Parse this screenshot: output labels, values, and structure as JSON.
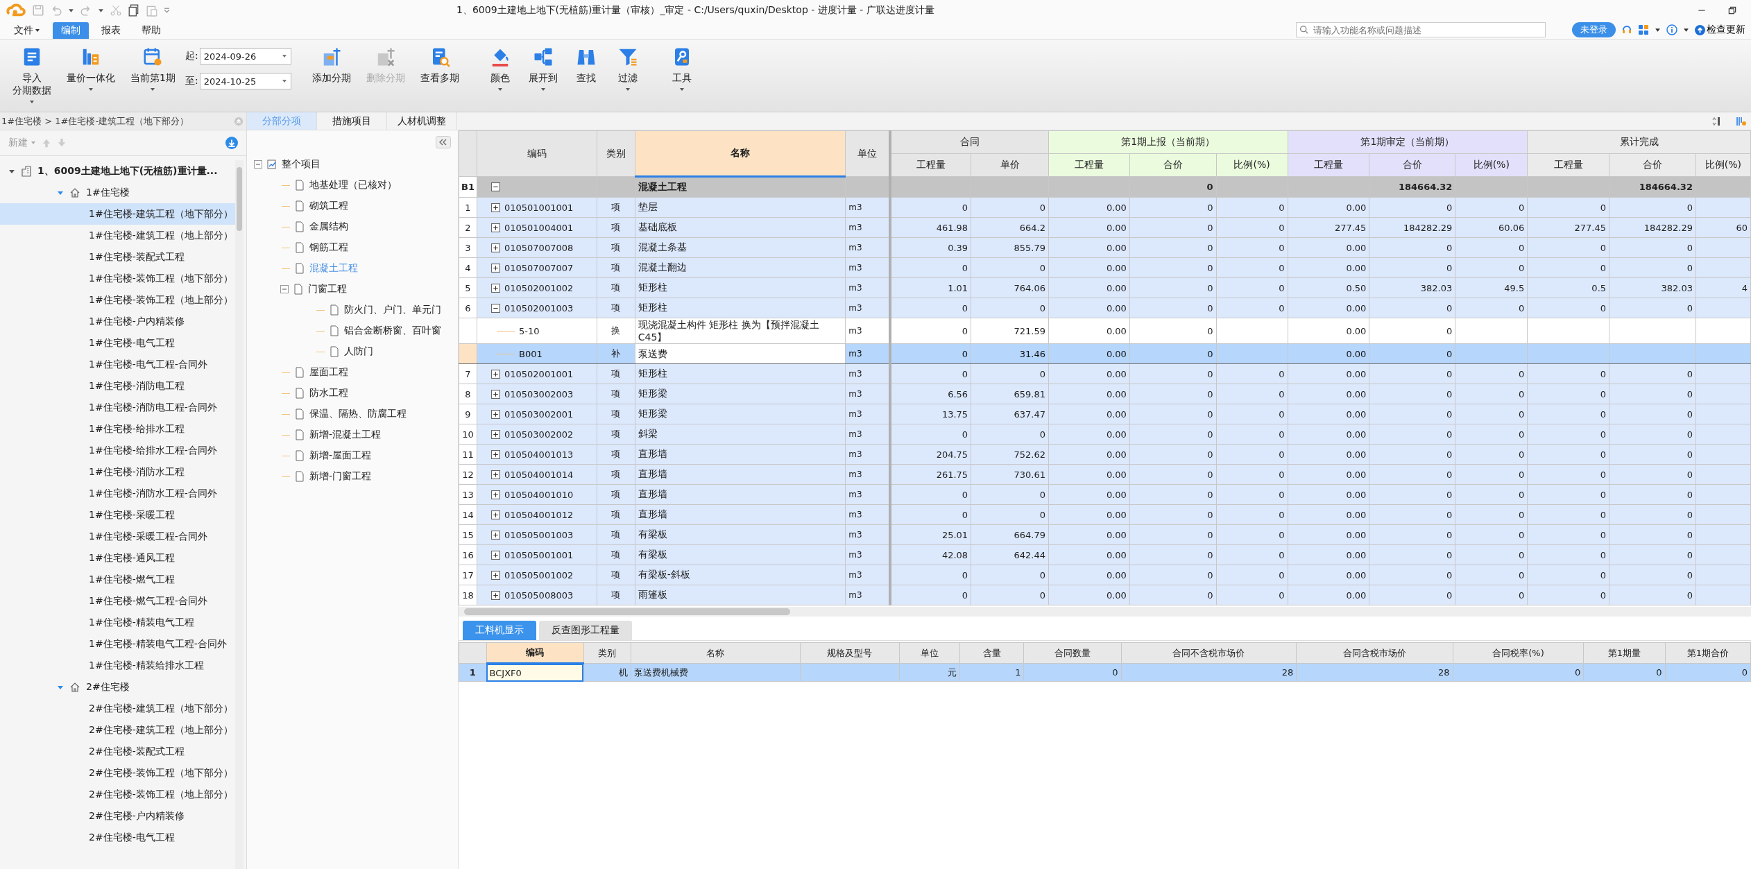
{
  "title_bar": {
    "title": "1、6009土建地上地下(无植筋)重计量（审核）_审定 - C:/Users/quxin/Desktop - 进度计量 - 广联达进度计量"
  },
  "menu": [
    {
      "label": "文件",
      "selected": false,
      "has_menu": true
    },
    {
      "label": "编制",
      "selected": true,
      "has_menu": false
    },
    {
      "label": "报表",
      "selected": false,
      "has_menu": false
    },
    {
      "label": "帮助",
      "selected": false,
      "has_menu": false
    }
  ],
  "search": {
    "placeholder": "请输入功能名称或问题描述"
  },
  "login_button": "未登录",
  "update_button": "检查更新",
  "ribbon": {
    "left_buttons": [
      {
        "label": "导入",
        "sub_label": "分期数据",
        "has_menu": true,
        "disabled": false
      },
      {
        "label": "量价一体化",
        "has_menu": true,
        "disabled": false
      },
      {
        "label": "当前第1期",
        "has_menu": true,
        "disabled": false
      }
    ],
    "period": {
      "start_label": "起:",
      "start": "2024-09-26",
      "end_label": "至:",
      "end": "2024-10-25"
    },
    "right_buttons": [
      {
        "label": "添加分期",
        "has_menu": false,
        "disabled": false
      },
      {
        "label": "删除分期",
        "has_menu": false,
        "disabled": true
      },
      {
        "label": "查看多期",
        "has_menu": false,
        "disabled": false
      },
      {
        "label": "颜色",
        "has_menu": true,
        "disabled": false
      },
      {
        "label": "展开到",
        "has_menu": true,
        "disabled": false
      },
      {
        "label": "查找",
        "has_menu": false,
        "disabled": false
      },
      {
        "label": "过滤",
        "has_menu": true,
        "disabled": false
      },
      {
        "label": "工具",
        "has_menu": true,
        "disabled": false
      }
    ]
  },
  "breadcrumb": "1#住宅楼 > 1#住宅楼-建筑工程（地下部分）",
  "view_tabs": [
    {
      "label": "分部分项",
      "selected": true
    },
    {
      "label": "措施项目",
      "selected": false
    },
    {
      "label": "人材机调整",
      "selected": false
    }
  ],
  "project_toolbar": {
    "new_button": "新建"
  },
  "project_tree": {
    "label": "1、6009土建地上地下(无植筋)重计量...",
    "expanded": true,
    "selected": false,
    "children": [
      {
        "label": "1#住宅楼",
        "expanded": true,
        "selected": false,
        "children": [
          {
            "label": "1#住宅楼-建筑工程（地下部分）",
            "selected": true
          },
          {
            "label": "1#住宅楼-建筑工程（地上部分）",
            "selected": false
          },
          {
            "label": "1#住宅楼-装配式工程",
            "selected": false
          },
          {
            "label": "1#住宅楼-装饰工程（地下部分）",
            "selected": false
          },
          {
            "label": "1#住宅楼-装饰工程（地上部分）",
            "selected": false
          },
          {
            "label": "1#住宅楼-户内精装修",
            "selected": false
          },
          {
            "label": "1#住宅楼-电气工程",
            "selected": false
          },
          {
            "label": "1#住宅楼-电气工程-合同外",
            "selected": false
          },
          {
            "label": "1#住宅楼-消防电工程",
            "selected": false
          },
          {
            "label": "1#住宅楼-消防电工程-合同外",
            "selected": false
          },
          {
            "label": "1#住宅楼-给排水工程",
            "selected": false
          },
          {
            "label": "1#住宅楼-给排水工程-合同外",
            "selected": false
          },
          {
            "label": "1#住宅楼-消防水工程",
            "selected": false
          },
          {
            "label": "1#住宅楼-消防水工程-合同外",
            "selected": false
          },
          {
            "label": "1#住宅楼-采暖工程",
            "selected": false
          },
          {
            "label": "1#住宅楼-采暖工程-合同外",
            "selected": false
          },
          {
            "label": "1#住宅楼-通风工程",
            "selected": false
          },
          {
            "label": "1#住宅楼-燃气工程",
            "selected": false
          },
          {
            "label": "1#住宅楼-燃气工程-合同外",
            "selected": false
          },
          {
            "label": "1#住宅楼-精装电气工程",
            "selected": false
          },
          {
            "label": "1#住宅楼-精装电气工程-合同外",
            "selected": false
          },
          {
            "label": "1#住宅楼-精装给排水工程",
            "selected": false
          }
        ]
      },
      {
        "label": "2#住宅楼",
        "expanded": true,
        "selected": false,
        "children": [
          {
            "label": "2#住宅楼-建筑工程（地下部分）",
            "selected": false
          },
          {
            "label": "2#住宅楼-建筑工程（地上部分）",
            "selected": false
          },
          {
            "label": "2#住宅楼-装配式工程",
            "selected": false
          },
          {
            "label": "2#住宅楼-装饰工程（地下部分）",
            "selected": false
          },
          {
            "label": "2#住宅楼-装饰工程（地上部分）",
            "selected": false
          },
          {
            "label": "2#住宅楼-户内精装修",
            "selected": false
          },
          {
            "label": "2#住宅楼-电气工程",
            "selected": false
          }
        ]
      }
    ]
  },
  "outline_tree": {
    "label": "整个项目",
    "expanded": true,
    "selected": false,
    "children": [
      {
        "label": "地基处理（已核对）",
        "selected": false
      },
      {
        "label": "砌筑工程",
        "selected": false
      },
      {
        "label": "金属结构",
        "selected": false
      },
      {
        "label": "钢筋工程",
        "selected": false
      },
      {
        "label": "混凝土工程",
        "selected": true
      },
      {
        "label": "门窗工程",
        "expanded": true,
        "selected": false,
        "children": [
          {
            "label": "防火门、户门、单元门",
            "selected": false
          },
          {
            "label": "铝合金断桥窗、百叶窗",
            "selected": false
          },
          {
            "label": "人防门",
            "selected": false
          }
        ]
      },
      {
        "label": "屋面工程",
        "selected": false
      },
      {
        "label": "防水工程",
        "selected": false
      },
      {
        "label": "保温、隔热、防腐工程",
        "selected": false
      },
      {
        "label": "新增-混凝土工程",
        "selected": false
      },
      {
        "label": "新增-屋面工程",
        "selected": false
      },
      {
        "label": "新增-门窗工程",
        "selected": false
      }
    ]
  },
  "table": {
    "fixed_columns": [
      {
        "label": "编码",
        "highlighted": false
      },
      {
        "label": "类别",
        "highlighted": false
      },
      {
        "label": "名称",
        "highlighted": true
      },
      {
        "label": "单位",
        "highlighted": false
      }
    ],
    "groups": [
      {
        "label": "合同",
        "color": "#e6e6e6",
        "columns": [
          "工程量",
          "单价"
        ]
      },
      {
        "label": "第1期上报（当前期）",
        "color": "#ebfbde",
        "columns": [
          "工程量",
          "合价",
          "比例(%)"
        ]
      },
      {
        "label": "第1期审定（当前期）",
        "color": "#e2e0fa",
        "columns": [
          "工程量",
          "合价",
          "比例(%)"
        ]
      },
      {
        "label": "累计完成",
        "color": "#ebebeb",
        "columns": [
          "工程量",
          "合价",
          "比例(%)"
        ]
      }
    ],
    "rows": [
      {
        "kind": "group",
        "no": "B1",
        "code": null,
        "type": null,
        "name": "混凝土工程",
        "unit": null,
        "expanded": true,
        "selected": false,
        "cells": [
          null,
          null,
          null,
          "0",
          null,
          null,
          "184664.32",
          null,
          null,
          "184664.32",
          null
        ]
      },
      {
        "kind": "item",
        "no": "1",
        "code": "010501001001",
        "type": "项",
        "name": "垫层",
        "unit": "m3",
        "expanded": false,
        "selected": false,
        "cells": [
          "0",
          "0",
          "0.00",
          "0",
          "0",
          "0.00",
          "0",
          "0",
          "0",
          "0",
          null
        ]
      },
      {
        "kind": "item",
        "no": "2",
        "code": "010501004001",
        "type": "项",
        "name": "基础底板",
        "unit": "m3",
        "expanded": false,
        "selected": false,
        "cells": [
          "461.98",
          "664.2",
          "0.00",
          "0",
          "0",
          "277.45",
          "184282.29",
          "60.06",
          "277.45",
          "184282.29",
          "60"
        ]
      },
      {
        "kind": "item",
        "no": "3",
        "code": "010507007008",
        "type": "项",
        "name": "混凝土条基",
        "unit": "m3",
        "expanded": false,
        "selected": false,
        "cells": [
          "0.39",
          "855.79",
          "0.00",
          "0",
          "0",
          "0.00",
          "0",
          "0",
          "0",
          "0",
          null
        ]
      },
      {
        "kind": "item",
        "no": "4",
        "code": "010507007007",
        "type": "项",
        "name": "混凝土翻边",
        "unit": "m3",
        "expanded": false,
        "selected": false,
        "cells": [
          "0",
          "0",
          "0.00",
          "0",
          "0",
          "0.00",
          "0",
          "0",
          "0",
          "0",
          null
        ]
      },
      {
        "kind": "item",
        "no": "5",
        "code": "010502001002",
        "type": "项",
        "name": "矩形柱",
        "unit": "m3",
        "expanded": false,
        "selected": false,
        "cells": [
          "1.01",
          "764.06",
          "0.00",
          "0",
          "0",
          "0.50",
          "382.03",
          "49.5",
          "0.5",
          "382.03",
          "4"
        ]
      },
      {
        "kind": "item",
        "no": "6",
        "code": "010502001003",
        "type": "项",
        "name": "矩形柱",
        "unit": "m3",
        "expanded": true,
        "selected": false,
        "cells": [
          "0",
          "0",
          "0.00",
          "0",
          "0",
          "0.00",
          "0",
          "0",
          "0",
          "0",
          null
        ]
      },
      {
        "kind": "sub",
        "no": null,
        "code": "5-10",
        "type": "换",
        "name": "现浇混凝土构件 矩形柱  换为【预拌混凝土C45】",
        "unit": "m3",
        "selected": false,
        "cells": [
          "0",
          "721.59",
          "0.00",
          "0",
          null,
          "0.00",
          "0",
          null,
          null,
          null,
          null
        ]
      },
      {
        "kind": "sub",
        "no": null,
        "code": "B001",
        "type": "补",
        "name": "泵送费",
        "unit": "m3",
        "selected": true,
        "cells": [
          "0",
          "31.46",
          "0.00",
          "0",
          null,
          "0.00",
          "0",
          null,
          null,
          null,
          null
        ]
      },
      {
        "kind": "item",
        "no": "7",
        "code": "010502001001",
        "type": "项",
        "name": "矩形柱",
        "unit": "m3",
        "expanded": false,
        "selected": false,
        "cells": [
          "0",
          "0",
          "0.00",
          "0",
          "0",
          "0.00",
          "0",
          "0",
          "0",
          "0",
          null
        ]
      },
      {
        "kind": "item",
        "no": "8",
        "code": "010503002003",
        "type": "项",
        "name": "矩形梁",
        "unit": "m3",
        "expanded": false,
        "selected": false,
        "cells": [
          "6.56",
          "659.81",
          "0.00",
          "0",
          "0",
          "0.00",
          "0",
          "0",
          "0",
          "0",
          null
        ]
      },
      {
        "kind": "item",
        "no": "9",
        "code": "010503002001",
        "type": "项",
        "name": "矩形梁",
        "unit": "m3",
        "expanded": false,
        "selected": false,
        "cells": [
          "13.75",
          "637.47",
          "0.00",
          "0",
          "0",
          "0.00",
          "0",
          "0",
          "0",
          "0",
          null
        ]
      },
      {
        "kind": "item",
        "no": "10",
        "code": "010503002002",
        "type": "项",
        "name": "斜梁",
        "unit": "m3",
        "expanded": false,
        "selected": false,
        "cells": [
          "0",
          "0",
          "0.00",
          "0",
          "0",
          "0.00",
          "0",
          "0",
          "0",
          "0",
          null
        ]
      },
      {
        "kind": "item",
        "no": "11",
        "code": "010504001013",
        "type": "项",
        "name": "直形墙",
        "unit": "m3",
        "expanded": false,
        "selected": false,
        "cells": [
          "204.75",
          "752.62",
          "0.00",
          "0",
          "0",
          "0.00",
          "0",
          "0",
          "0",
          "0",
          null
        ]
      },
      {
        "kind": "item",
        "no": "12",
        "code": "010504001014",
        "type": "项",
        "name": "直形墙",
        "unit": "m3",
        "expanded": false,
        "selected": false,
        "cells": [
          "261.75",
          "730.61",
          "0.00",
          "0",
          "0",
          "0.00",
          "0",
          "0",
          "0",
          "0",
          null
        ]
      },
      {
        "kind": "item",
        "no": "13",
        "code": "010504001010",
        "type": "项",
        "name": "直形墙",
        "unit": "m3",
        "expanded": false,
        "selected": false,
        "cells": [
          "0",
          "0",
          "0.00",
          "0",
          "0",
          "0.00",
          "0",
          "0",
          "0",
          "0",
          null
        ]
      },
      {
        "kind": "item",
        "no": "14",
        "code": "010504001012",
        "type": "项",
        "name": "直形墙",
        "unit": "m3",
        "expanded": false,
        "selected": false,
        "cells": [
          "0",
          "0",
          "0.00",
          "0",
          "0",
          "0.00",
          "0",
          "0",
          "0",
          "0",
          null
        ]
      },
      {
        "kind": "item",
        "no": "15",
        "code": "010505001003",
        "type": "项",
        "name": "有梁板",
        "unit": "m3",
        "expanded": false,
        "selected": false,
        "cells": [
          "25.01",
          "664.79",
          "0.00",
          "0",
          "0",
          "0.00",
          "0",
          "0",
          "0",
          "0",
          null
        ]
      },
      {
        "kind": "item",
        "no": "16",
        "code": "010505001001",
        "type": "项",
        "name": "有梁板",
        "unit": "m3",
        "expanded": false,
        "selected": false,
        "cells": [
          "42.08",
          "642.44",
          "0.00",
          "0",
          "0",
          "0.00",
          "0",
          "0",
          "0",
          "0",
          null
        ]
      },
      {
        "kind": "item",
        "no": "17",
        "code": "010505001002",
        "type": "项",
        "name": "有梁板-斜板",
        "unit": "m3",
        "expanded": false,
        "selected": false,
        "cells": [
          "0",
          "0",
          "0.00",
          "0",
          "0",
          "0.00",
          "0",
          "0",
          "0",
          "0",
          null
        ]
      },
      {
        "kind": "item",
        "no": "18",
        "code": "010505008003",
        "type": "项",
        "name": "雨篷板",
        "unit": "m3",
        "expanded": false,
        "selected": false,
        "cells": [
          "0",
          "0",
          "0.00",
          "0",
          "0",
          "0.00",
          "0",
          "0",
          "0",
          "0",
          null
        ]
      }
    ]
  },
  "bottom_tabs": [
    {
      "label": "工料机显示",
      "selected": true
    },
    {
      "label": "反查图形工程量",
      "selected": false
    }
  ],
  "resource_table": {
    "columns": [
      {
        "label": "编码",
        "highlighted": true
      },
      {
        "label": "类别",
        "highlighted": false
      },
      {
        "label": "名称",
        "highlighted": false
      },
      {
        "label": "规格及型号",
        "highlighted": false
      },
      {
        "label": "单位",
        "highlighted": false
      },
      {
        "label": "含量",
        "highlighted": false
      },
      {
        "label": "合同数量",
        "highlighted": false
      },
      {
        "label": "合同不含税市场价",
        "highlighted": false
      },
      {
        "label": "合同含税市场价",
        "highlighted": false
      },
      {
        "label": "合同税率(%)",
        "highlighted": false
      },
      {
        "label": "第1期量",
        "highlighted": false
      },
      {
        "label": "第1期合价",
        "highlighted": false
      }
    ],
    "rows": [
      {
        "no": "1",
        "selected": true,
        "cells": [
          "BCJXF0",
          "机",
          "泵送费机械费",
          null,
          "元",
          "1",
          "0",
          "28",
          "28",
          "0",
          "0",
          "0"
        ]
      }
    ]
  }
}
